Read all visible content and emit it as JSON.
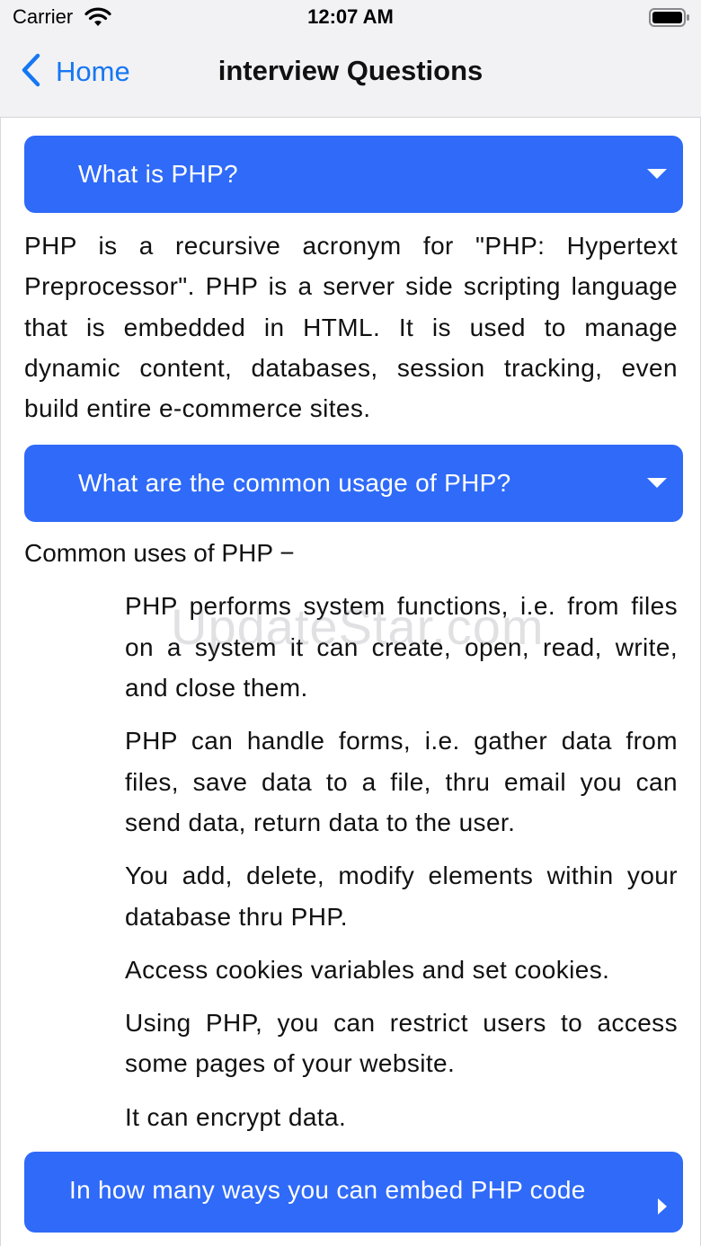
{
  "status_bar": {
    "carrier": "Carrier",
    "time": "12:07 AM"
  },
  "nav": {
    "back_label": "Home",
    "title": "interview Questions",
    "accent_color": "#1677f2"
  },
  "faq": {
    "header_color": "#2f6af8",
    "items": [
      {
        "question": "What is PHP?",
        "answer": "PHP is a recursive acronym for \"PHP: Hypertext Preprocessor\". PHP is a server side scripting language that is embedded in HTML. It is used to manage dynamic content, databases, session tracking, even build entire e-commerce sites."
      },
      {
        "question": "What are the common usage of PHP?",
        "intro": "Common uses of PHP −",
        "list": [
          "PHP performs system functions, i.e. from files on a system it can create, open, read, write, and close them.",
          "PHP can handle forms, i.e. gather data from files, save data to a file, thru email you can send data, return data to the user.",
          "You add, delete, modify elements within your database thru PHP.",
          "Access cookies variables and set cookies.",
          "Using PHP, you can restrict users to access some pages of your website.",
          "It can encrypt data."
        ]
      },
      {
        "question": "In how many ways you can embed PHP code"
      }
    ]
  },
  "watermark": "UpdateStar.com"
}
